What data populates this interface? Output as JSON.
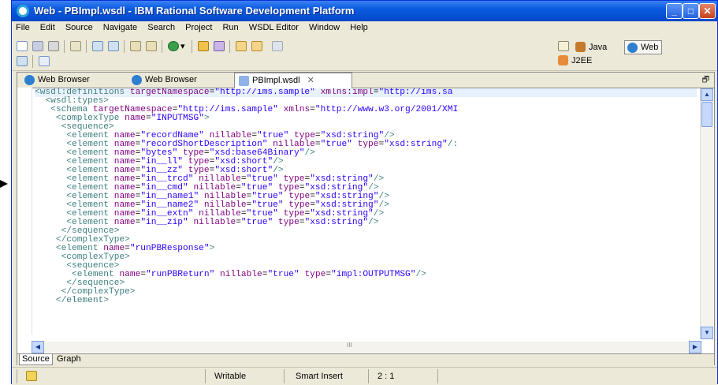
{
  "window": {
    "title": "Web - PBImpl.wsdl - IBM Rational Software Development Platform"
  },
  "menu": [
    "File",
    "Edit",
    "Source",
    "Navigate",
    "Search",
    "Project",
    "Run",
    "WSDL Editor",
    "Window",
    "Help"
  ],
  "perspectives": {
    "java": "Java",
    "web": "Web",
    "j2ee": "J2EE"
  },
  "tabs": [
    {
      "label": "Web Browser"
    },
    {
      "label": "Web Browser"
    },
    {
      "label": "PBImpl.wsdl",
      "close": "✕"
    }
  ],
  "editor": {
    "lines": [
      "<wsdl:definitions targetNamespace=\"http://ims.sample\" xmlns:impl=\"http://ims.sa",
      "  <wsdl:types>",
      "   <schema targetNamespace=\"http://ims.sample\" xmlns=\"http://www.w3.org/2001/XMI",
      "    <complexType name=\"INPUTMSG\">",
      "     <sequence>",
      "      <element name=\"recordName\" nillable=\"true\" type=\"xsd:string\"/>",
      "      <element name=\"recordShortDescription\" nillable=\"true\" type=\"xsd:string\"/:",
      "      <element name=\"bytes\" type=\"xsd:base64Binary\"/>",
      "      <element name=\"in__ll\" type=\"xsd:short\"/>",
      "      <element name=\"in__zz\" type=\"xsd:short\"/>",
      "      <element name=\"in__trcd\" nillable=\"true\" type=\"xsd:string\"/>",
      "      <element name=\"in__cmd\" nillable=\"true\" type=\"xsd:string\"/>",
      "      <element name=\"in__name1\" nillable=\"true\" type=\"xsd:string\"/>",
      "      <element name=\"in__name2\" nillable=\"true\" type=\"xsd:string\"/>",
      "      <element name=\"in__extn\" nillable=\"true\" type=\"xsd:string\"/>",
      "      <element name=\"in__zip\" nillable=\"true\" type=\"xsd:string\"/>",
      "     </sequence>",
      "    </complexType>",
      "    <element name=\"runPBResponse\">",
      "     <complexType>",
      "      <sequence>",
      "       <element name=\"runPBReturn\" nillable=\"true\" type=\"impl:OUTPUTMSG\"/>",
      "      </sequence>",
      "     </complexType>",
      "    </element>"
    ],
    "hscroll_label": "III"
  },
  "bottom_tabs": [
    "Source",
    "Graph"
  ],
  "status": {
    "mode": "Writable",
    "insert": "Smart Insert",
    "position": "2 : 1"
  }
}
